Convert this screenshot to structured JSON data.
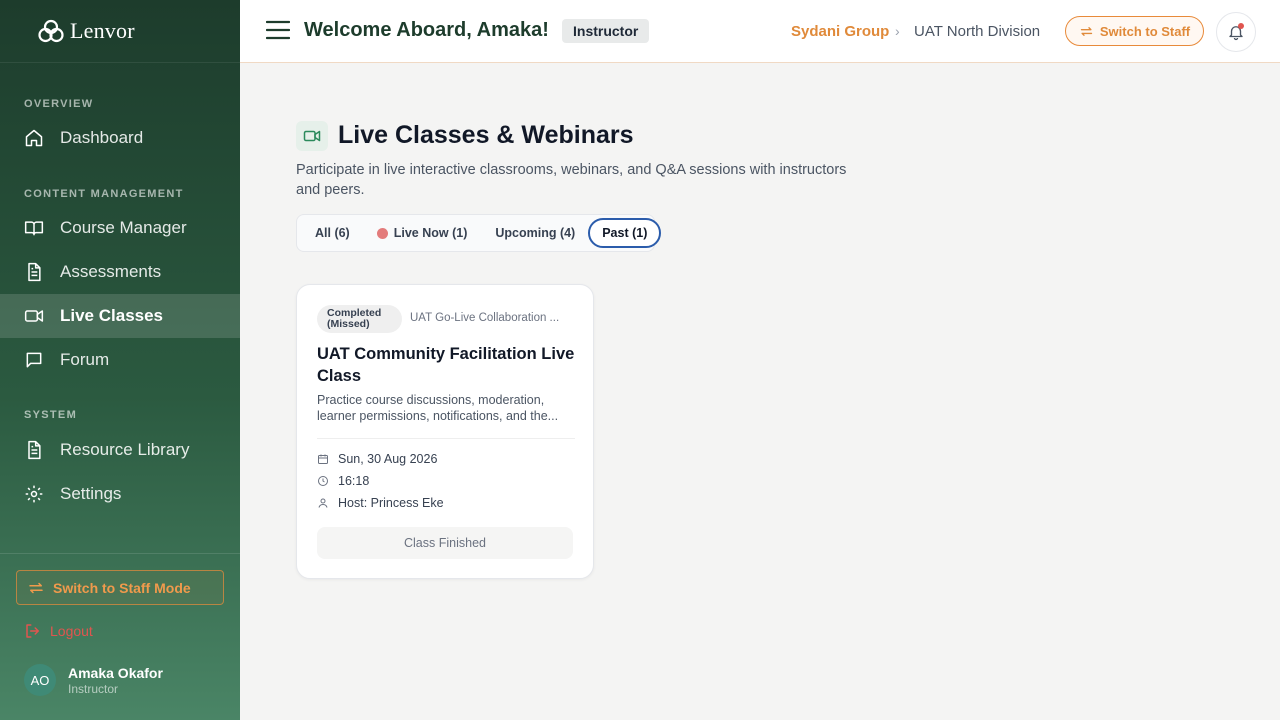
{
  "app": {
    "brand": "Lenvor",
    "accent_color": "#e08a3a",
    "sidebar_color": "#1d3c2c"
  },
  "sidebar": {
    "sections": [
      {
        "label": "OVERVIEW",
        "items": [
          {
            "label": "Dashboard",
            "icon": "home-icon"
          }
        ]
      },
      {
        "label": "CONTENT MANAGEMENT",
        "items": [
          {
            "label": "Course Manager",
            "icon": "book-icon"
          },
          {
            "label": "Assessments",
            "icon": "document-icon"
          },
          {
            "label": "Live Classes",
            "icon": "video-icon",
            "active": true
          },
          {
            "label": "Forum",
            "icon": "chat-icon"
          }
        ]
      },
      {
        "label": "SYSTEM",
        "items": [
          {
            "label": "Resource Library",
            "icon": "document-icon"
          },
          {
            "label": "Settings",
            "icon": "gear-icon"
          }
        ]
      }
    ],
    "switch_mode_label": "Switch to Staff Mode",
    "logout_label": "Logout",
    "user": {
      "initials": "AO",
      "name": "Amaka Okafor",
      "role": "Instructor"
    }
  },
  "header": {
    "welcome": "Welcome Aboard, Amaka!",
    "role_badge": "Instructor",
    "breadcrumb": {
      "org": "Sydani Group",
      "separator": "›",
      "division": "UAT North Division"
    },
    "switch_staff_label": "Switch to Staff",
    "notification_indicator": true
  },
  "main": {
    "title": "Live Classes & Webinars",
    "subtitle": "Participate in live interactive classrooms, webinars, and Q&A sessions with instructors and peers.",
    "tabs": [
      {
        "label": "All (6)"
      },
      {
        "label": "Live Now (1)",
        "live_dot": true
      },
      {
        "label": "Upcoming (4)"
      },
      {
        "label": "Past (1)",
        "active": true
      }
    ],
    "cards": [
      {
        "status": "Completed (Missed)",
        "course": "UAT Go-Live Collaboration ...",
        "title": "UAT Community Facilitation Live Class",
        "description": "Practice course discussions, moderation, learner permissions, notifications, and the...",
        "date": "Sun, 30 Aug 2026",
        "time": "16:18",
        "host": "Host: Princess Eke",
        "action": "Class Finished"
      }
    ]
  }
}
